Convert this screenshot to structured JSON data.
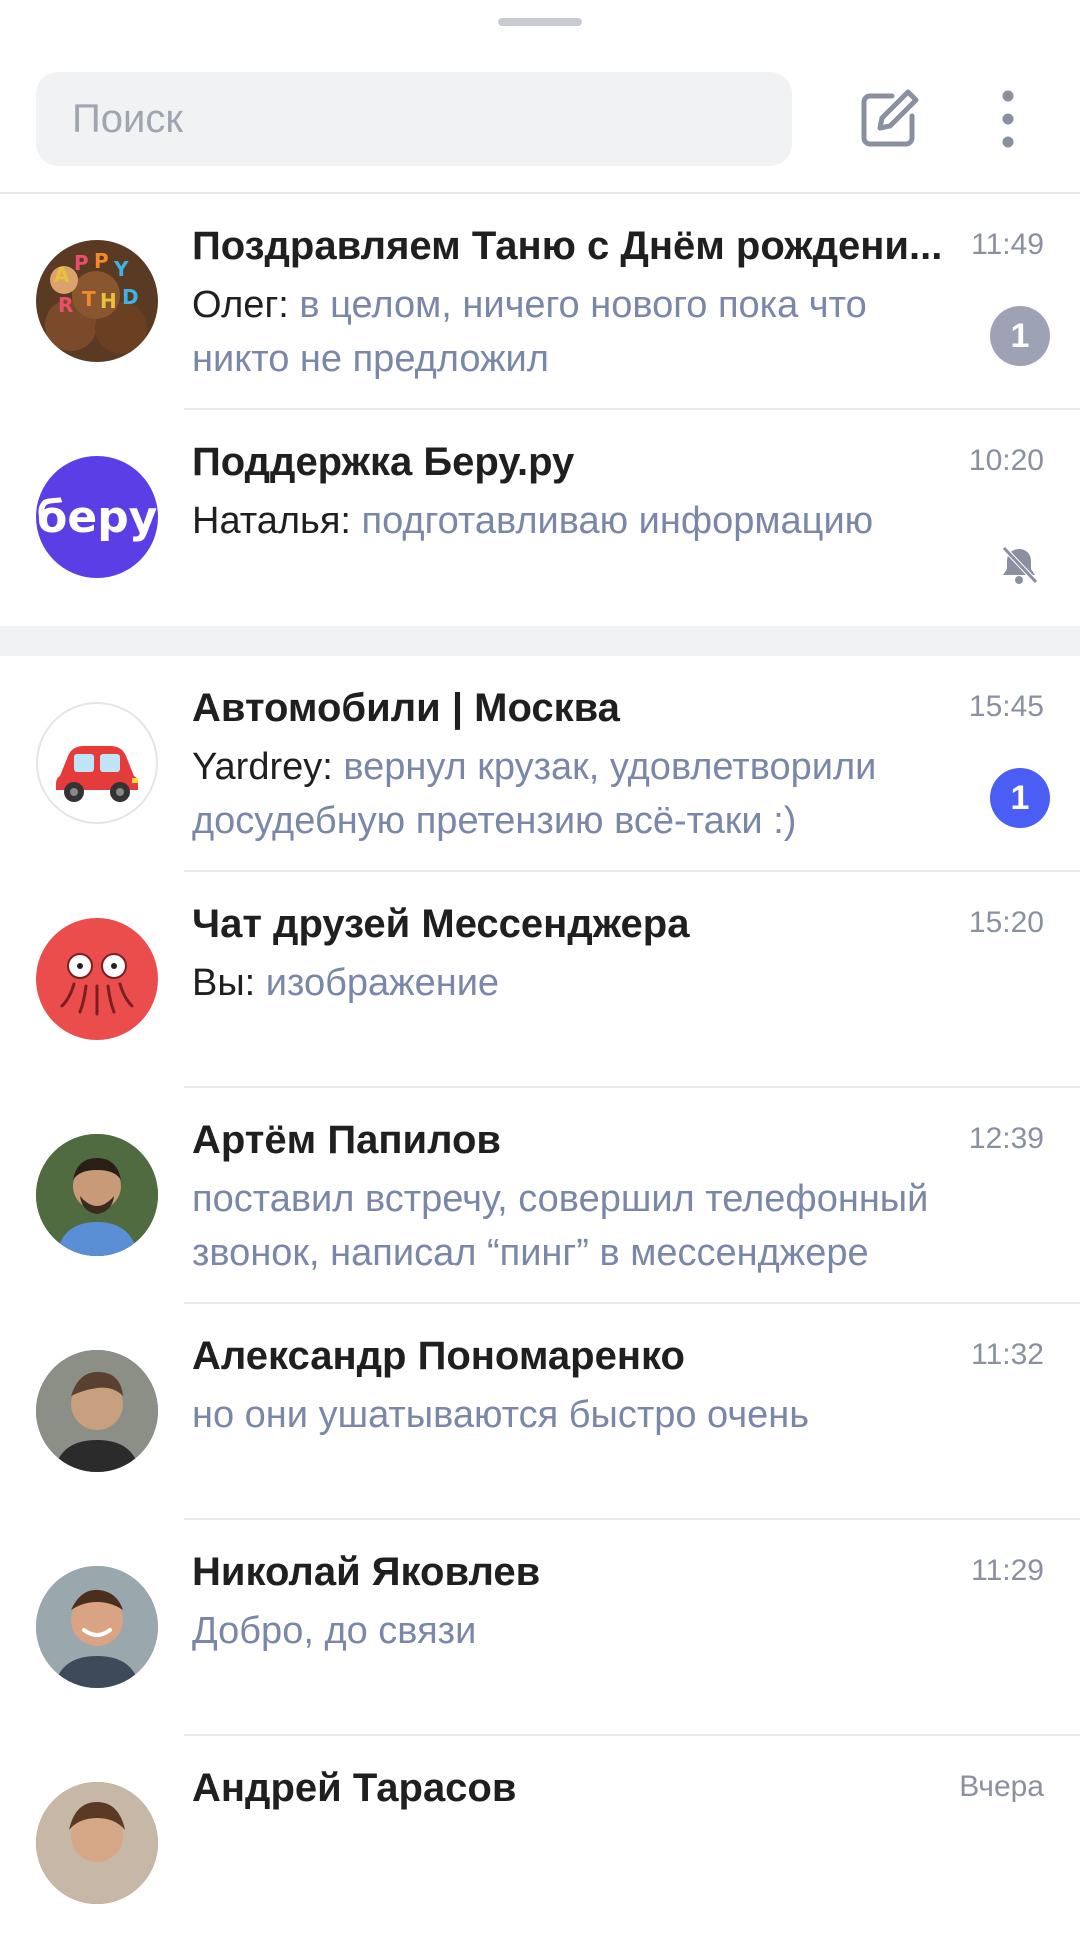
{
  "search": {
    "placeholder": "Поиск"
  },
  "icons": {
    "compose": "compose-icon",
    "more": "more-vertical-icon",
    "muted": "bell-muted-icon"
  },
  "colors": {
    "badge_muted": "#9da3b4",
    "badge_active": "#4a5ef5",
    "text_secondary": "#7b87a8",
    "beru_brand": "#5b3ee6"
  },
  "chats": [
    {
      "title": "Поздравляем Таню с Днём рождени...",
      "author": "Олег:",
      "message": "в целом, ничего нового пока что никто не предложил",
      "time": "11:49",
      "badge": "1",
      "avatar": "birthday-cupcakes"
    },
    {
      "title": "Поддержка Беру.ру",
      "author": "Наталья:",
      "message": "подготавливаю информацию",
      "time": "10:20",
      "muted": true,
      "avatar_text": "беру"
    },
    {
      "title": "Автомобили | Москва",
      "author": "Yardrey:",
      "message": "вернул крузак, удовлетворили досудебную претензию всё-таки :)",
      "time": "15:45",
      "badge": "1",
      "avatar": "red-car"
    },
    {
      "title": "Чат друзей Мессенджера",
      "author": "Вы:",
      "message": "изображение",
      "time": "15:20",
      "avatar": "octopus"
    },
    {
      "title": "Артём Папилов",
      "author": "",
      "message": "поставил встречу, совершил телефонный звонок, написал “пинг” в мессенджере",
      "time": "12:39",
      "avatar": "person-photo"
    },
    {
      "title": "Александр Пономаренко",
      "author": "",
      "message": "но они ушатываются быстро очень",
      "time": "11:32",
      "avatar": "person-photo"
    },
    {
      "title": "Николай Яковлев",
      "author": "",
      "message": "Добро, до связи",
      "time": "11:29",
      "avatar": "person-photo"
    },
    {
      "title": "Андрей Тарасов",
      "author": "",
      "message": "",
      "time": "Вчера",
      "avatar": "person-photo"
    }
  ]
}
